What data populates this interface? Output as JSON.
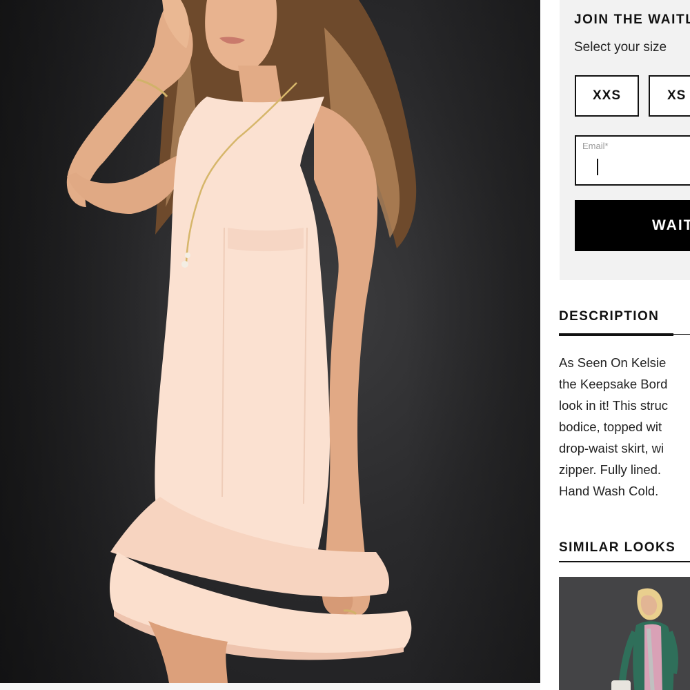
{
  "product_image": {
    "alt": ""
  },
  "waitlist": {
    "title": "JOIN THE WAITLIST",
    "subtitle": "Select your size",
    "sizes": [
      "XXS",
      "XS"
    ],
    "email_label": "Email*",
    "button_label": "WAITLIST"
  },
  "description": {
    "title": "DESCRIPTION",
    "lines": [
      "As Seen On Kelsie",
      "the Keepsake Bord",
      "look in it! This struc",
      "bodice, topped wit",
      "drop-waist skirt, wi",
      "zipper. Fully lined.",
      "Hand Wash Cold."
    ]
  },
  "similar_looks": {
    "title": "SIMILAR LOOKS"
  },
  "colors": {
    "background_dark": "#2a2a2c",
    "dress": "#f9dccb",
    "panel_gray": "#f2f2f2",
    "black": "#000000"
  }
}
